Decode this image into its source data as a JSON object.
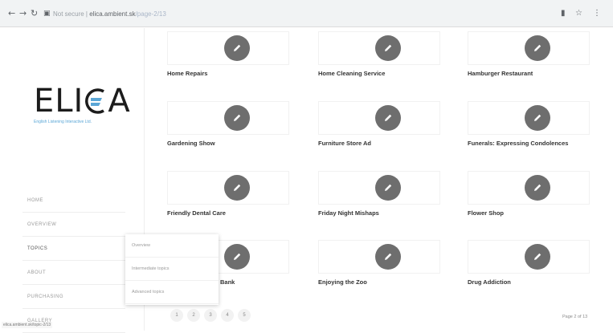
{
  "browser": {
    "back_icon": "arrow-left-icon",
    "forward_icon": "arrow-right-icon",
    "reload_icon": "reload-icon",
    "address_host": "elica.ambient.sk",
    "address_rest": "/page-2/13",
    "address_prefix": "Not secure |"
  },
  "logo": {
    "text_left": "ELI",
    "text_right": "A",
    "subtitle": "English Listening Interactive Ltd."
  },
  "sidebar": {
    "items": [
      {
        "label": "HOME"
      },
      {
        "label": "OVERVIEW"
      },
      {
        "label": "TOPICS"
      },
      {
        "label": "ABOUT"
      },
      {
        "label": "PURCHASING"
      },
      {
        "label": "GALLERY"
      }
    ],
    "status_url": "elica.ambient.sk/topic-2/13"
  },
  "dropdown": {
    "items": [
      {
        "label": "Overview"
      },
      {
        "label": "Intermediate topics"
      },
      {
        "label": "Advanced topics"
      }
    ]
  },
  "cards": [
    {
      "title": "Home Repairs"
    },
    {
      "title": "Home Cleaning Service"
    },
    {
      "title": "Hamburger Restaurant"
    },
    {
      "title": "Gardening Show"
    },
    {
      "title": "Furniture Store Ad"
    },
    {
      "title": "Funerals: Expressing Condolences"
    },
    {
      "title": "Friendly Dental Care"
    },
    {
      "title": "Friday Night Mishaps"
    },
    {
      "title": "Flower Shop"
    },
    {
      "title": "Bank"
    },
    {
      "title": "Enjoying the Zoo"
    },
    {
      "title": "Drug Addiction"
    }
  ],
  "pagination": {
    "pages": [
      "1",
      "2",
      "3",
      "4",
      "5"
    ],
    "info": "Page 2 of 13"
  },
  "colors": {
    "pen_circle": "#6e6e6e",
    "logo_accent": "#5aa6d6"
  }
}
